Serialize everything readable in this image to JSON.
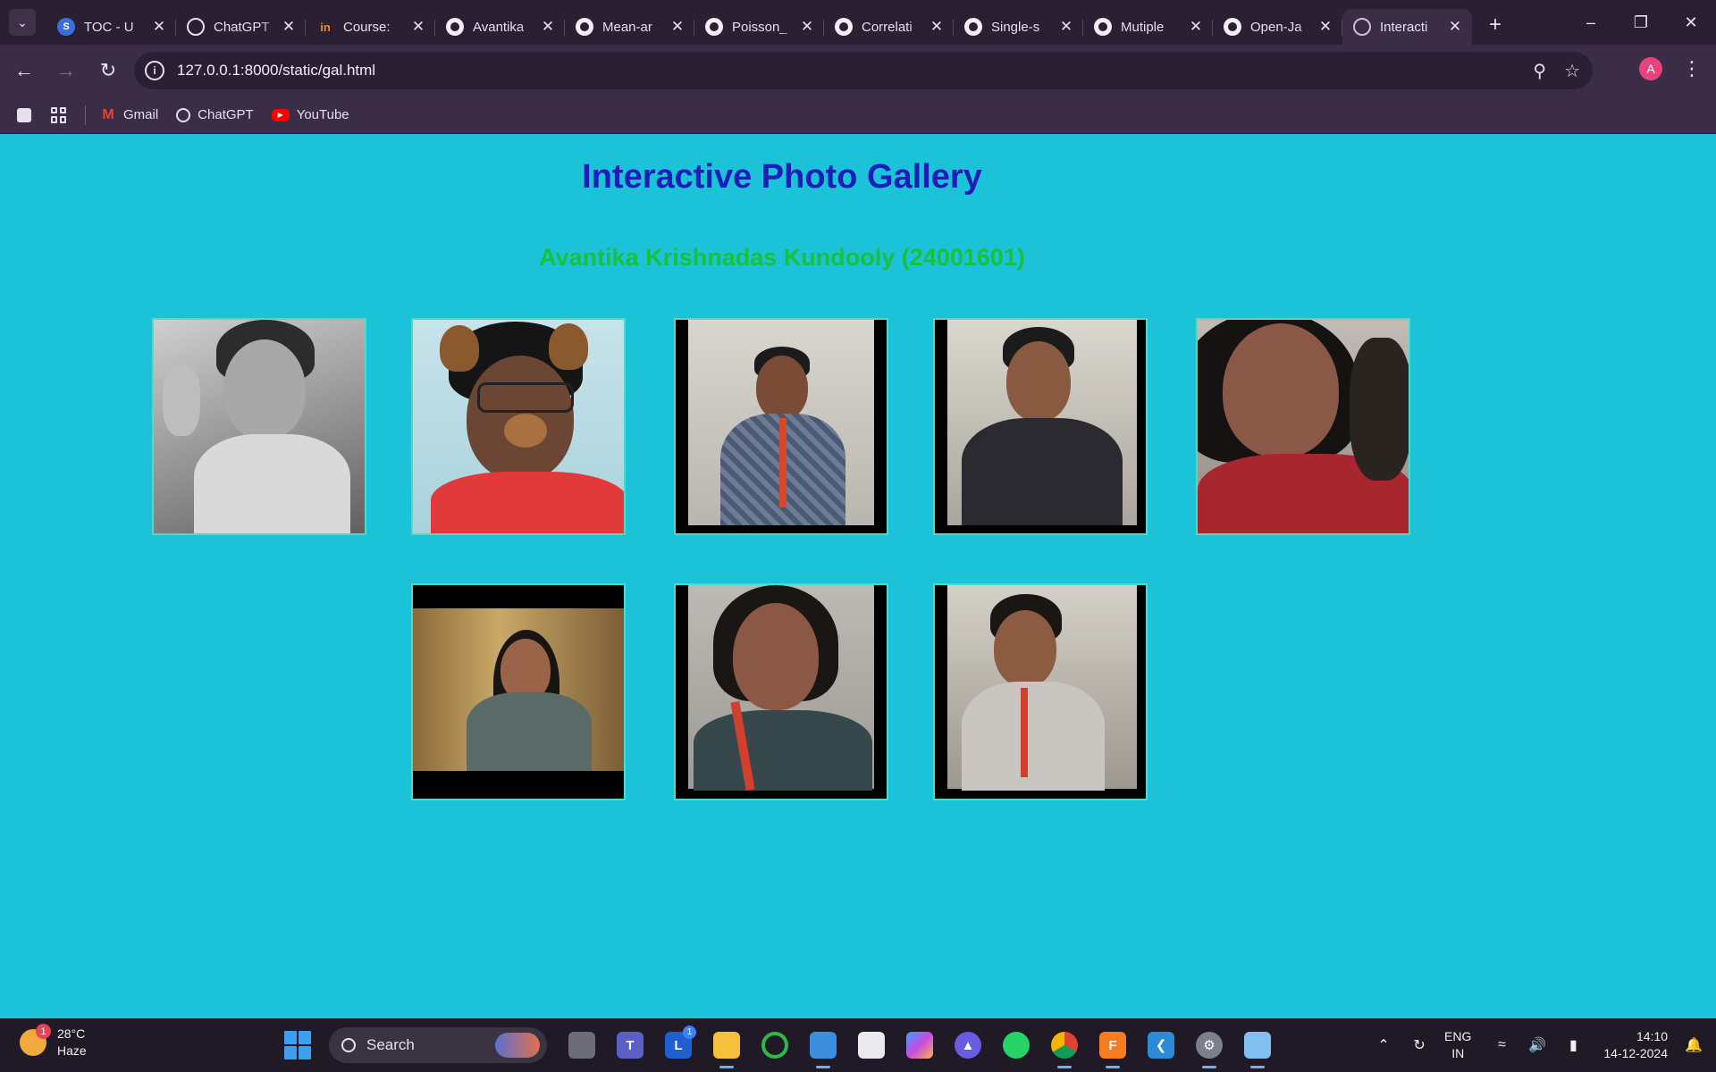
{
  "browser": {
    "tabs": [
      {
        "title": "TOC - U",
        "icon": "toc-icon"
      },
      {
        "title": "ChatGPT",
        "icon": "chatgpt-icon"
      },
      {
        "title": "Course:",
        "icon": "coursera-icon"
      },
      {
        "title": "Avantika",
        "icon": "github-icon"
      },
      {
        "title": "Mean-ar",
        "icon": "github-icon"
      },
      {
        "title": "Poisson_",
        "icon": "github-icon"
      },
      {
        "title": "Correlati",
        "icon": "github-icon"
      },
      {
        "title": "Single-s",
        "icon": "github-icon"
      },
      {
        "title": "Mutiple",
        "icon": "github-icon"
      },
      {
        "title": "Open-Ja",
        "icon": "github-icon"
      },
      {
        "title": "Interacti",
        "icon": "globe-icon",
        "active": true
      }
    ],
    "url": "127.0.0.1:8000/static/gal.html",
    "profile_initial": "A",
    "bookmarks": [
      {
        "label": "Gmail",
        "icon": "gmail-icon"
      },
      {
        "label": "ChatGPT",
        "icon": "chatgpt-icon"
      },
      {
        "label": "YouTube",
        "icon": "youtube-icon"
      }
    ]
  },
  "page": {
    "title": "Interactive Photo Gallery",
    "author": "Avantika Krishnadas Kundooly (24001601)",
    "photos": [
      {
        "name": "photo-1",
        "description": "grayscale selfie"
      },
      {
        "name": "photo-2",
        "description": "selfie with dog filter"
      },
      {
        "name": "photo-3",
        "description": "student in checked shirt"
      },
      {
        "name": "photo-4",
        "description": "student in dark shirt"
      },
      {
        "name": "photo-5",
        "description": "selfie in red top"
      },
      {
        "name": "photo-6",
        "description": "portrait indoors"
      },
      {
        "name": "photo-7",
        "description": "student with lanyard"
      },
      {
        "name": "photo-8",
        "description": "student in light shirt"
      }
    ]
  },
  "taskbar": {
    "weather": {
      "temp": "28°C",
      "condition": "Haze",
      "badge": "1"
    },
    "search_label": "Search",
    "language": {
      "line1": "ENG",
      "line2": "IN"
    },
    "clock": {
      "time": "14:10",
      "date": "14-12-2024"
    },
    "accent": "#1cc3d8"
  }
}
